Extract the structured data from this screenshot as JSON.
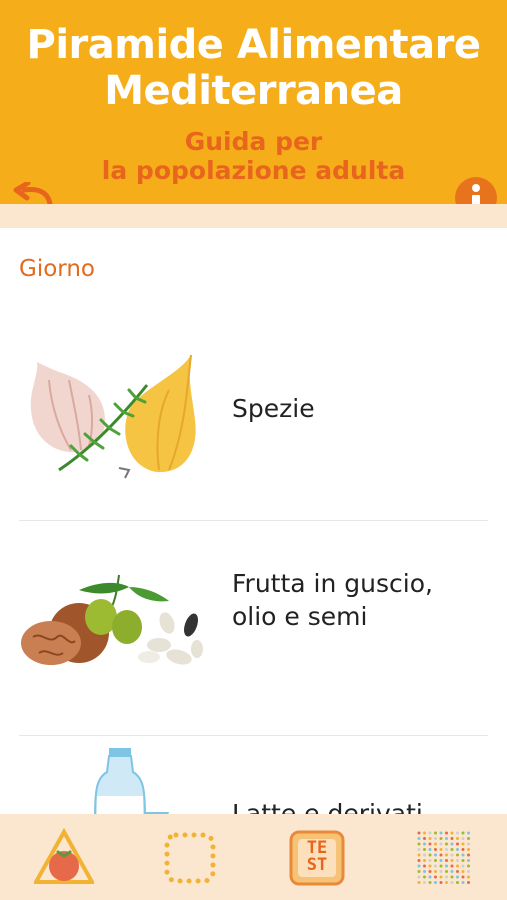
{
  "header": {
    "title_line1": "Piramide Alimentare",
    "title_line2": "Mediterranea",
    "subtitle_line1": "Guida per",
    "subtitle_line2": "la popolazione adulta"
  },
  "section": {
    "title": "Giorno"
  },
  "items": [
    {
      "label": "Spezie",
      "icon": "spices-illustration"
    },
    {
      "label_line1": "Frutta in guscio,",
      "label_line2": "olio e semi",
      "icon": "nuts-olives-seeds-illustration"
    },
    {
      "label": "Latte e derivati",
      "icon": "milk-bottle-illustration"
    }
  ],
  "tabbar": {
    "tabs": [
      {
        "name": "pyramid-tab",
        "icon": "tomato-pyramid-icon"
      },
      {
        "name": "frame-tab",
        "icon": "dotted-square-icon"
      },
      {
        "name": "test-tab",
        "icon": "test-icon",
        "text_top": "TE",
        "text_bottom": "ST"
      },
      {
        "name": "grid-tab",
        "icon": "dot-grid-icon"
      }
    ]
  },
  "colors": {
    "header": "#f6ad1a",
    "accent_orange": "#e8651e",
    "tabbar": "#fbe6cf"
  }
}
